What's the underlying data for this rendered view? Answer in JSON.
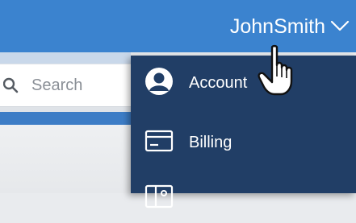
{
  "header": {
    "username": "JohnSmith",
    "chevron_icon": "chevron-down-icon",
    "background": "#3b83cf"
  },
  "search": {
    "placeholder": "Search",
    "icon": "search-icon"
  },
  "menu": {
    "background": "#213e66",
    "items": [
      {
        "label": "Account",
        "icon": "user-circle-icon"
      },
      {
        "label": "Billing",
        "icon": "credit-card-icon"
      },
      {
        "label": "",
        "icon": "id-card-icon"
      }
    ]
  },
  "cursor": {
    "icon": "hand-pointer-icon"
  }
}
